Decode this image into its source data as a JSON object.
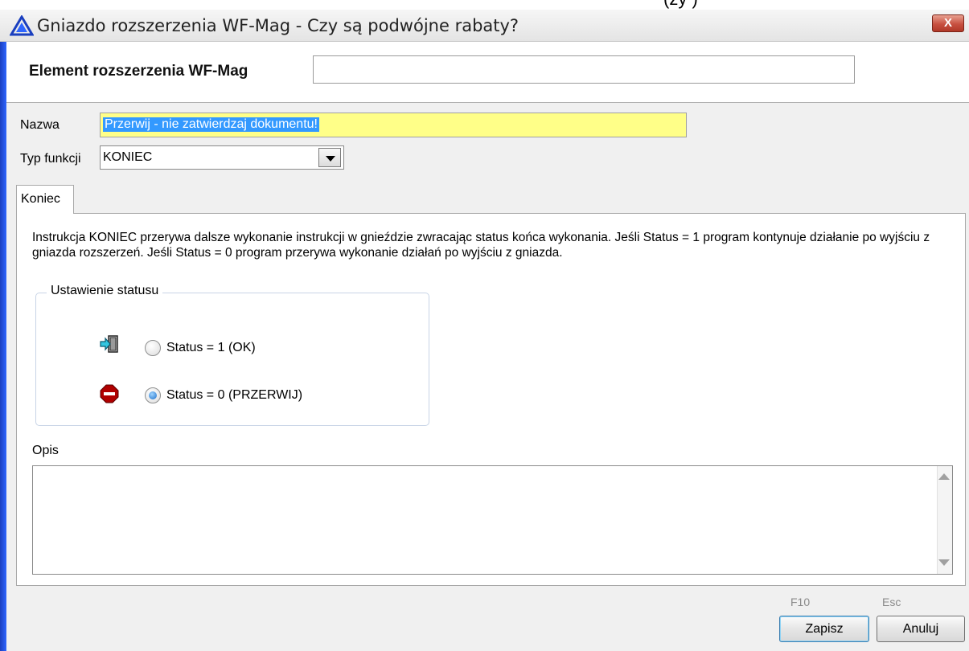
{
  "window": {
    "title": "Gniazdo rozszerzenia WF-Mag - Czy są podwójne rabaty?",
    "close_label": "X"
  },
  "background_window": {
    "text_fragment_left": "",
    "text_fragment_right": "(zy    )"
  },
  "element": {
    "label": "Element rozszerzenia WF-Mag",
    "value": ""
  },
  "form": {
    "nazwa_label": "Nazwa",
    "nazwa_value": "Przerwij - nie zatwierdzaj dokumentu!",
    "typ_label": "Typ funkcji",
    "typ_value": "KONIEC"
  },
  "tabs": [
    {
      "label": "Koniec",
      "active": true
    }
  ],
  "koniec": {
    "description": "Instrukcja KONIEC przerywa dalsze wykonanie instrukcji w gnieździe zwracając status końca wykonania. Jeśli Status = 1 program kontynuje działanie po wyjściu z gniazda rozszerzeń. Jeśli Status = 0 program przerywa wykonanie działań po wyjściu z gniazda.",
    "group_label": "Ustawienie statusu",
    "options": [
      {
        "label": "Status = 1 (OK)",
        "selected": false,
        "icon": "exit-door-icon"
      },
      {
        "label": "Status = 0 (PRZERWIJ)",
        "selected": true,
        "icon": "stop-icon"
      }
    ]
  },
  "opis": {
    "label": "Opis",
    "value": ""
  },
  "buttons": {
    "save_label": "Zapisz",
    "save_hint": "F10",
    "cancel_label": "Anuluj",
    "cancel_hint": "Esc"
  },
  "colors": {
    "window_frame": "#2d5fe0",
    "highlight_field": "#ffff88",
    "selection": "#3399ff",
    "close_button": "#c75040"
  }
}
